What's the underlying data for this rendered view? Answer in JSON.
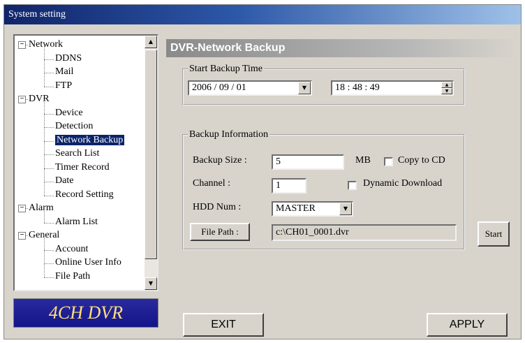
{
  "window": {
    "title": "System setting"
  },
  "tree": {
    "items": [
      {
        "label": "Network",
        "expander": "−"
      },
      {
        "label": "DDNS"
      },
      {
        "label": "Mail"
      },
      {
        "label": "FTP"
      },
      {
        "label": "DVR",
        "expander": "−"
      },
      {
        "label": "Device"
      },
      {
        "label": "Detection"
      },
      {
        "label": "Network Backup",
        "selected": true
      },
      {
        "label": "Search List"
      },
      {
        "label": "Timer Record"
      },
      {
        "label": "Date"
      },
      {
        "label": "Record Setting"
      },
      {
        "label": "Alarm",
        "expander": "−"
      },
      {
        "label": "Alarm List"
      },
      {
        "label": "General",
        "expander": "−"
      },
      {
        "label": "Account"
      },
      {
        "label": "Online User Info"
      },
      {
        "label": "File Path"
      }
    ],
    "scroll_up": "▲",
    "scroll_down": "▼"
  },
  "logo": {
    "text": "4CH DVR"
  },
  "section": {
    "title": "DVR-Network Backup"
  },
  "start_backup": {
    "legend": "Start Backup Time",
    "date_value": "2006 / 09 / 01",
    "time_value": "18 : 48 : 49"
  },
  "backup_info": {
    "legend": "Backup Information",
    "size_label": "Backup Size :",
    "size_value": "5",
    "size_unit": "MB",
    "copy_to_cd_label": "Copy to CD",
    "copy_to_cd_checked": false,
    "channel_label": "Channel :",
    "channel_value": "1",
    "dynamic_download_label": "Dynamic Download",
    "dynamic_download_checked": false,
    "hdd_label": "HDD Num :",
    "hdd_value": "MASTER",
    "file_path_button": "File Path :",
    "file_path_value": "c:\\CH01_0001.dvr"
  },
  "buttons": {
    "start": "Start",
    "exit": "EXIT",
    "apply": "APPLY"
  },
  "icons": {
    "dropdown": "▼",
    "spin_up": "▲",
    "spin_down": "▼"
  },
  "colors": {
    "title_bar": "#10246a",
    "selection": "#0a246a",
    "logo_bg": "#14148a",
    "logo_text": "#ffe27a"
  }
}
